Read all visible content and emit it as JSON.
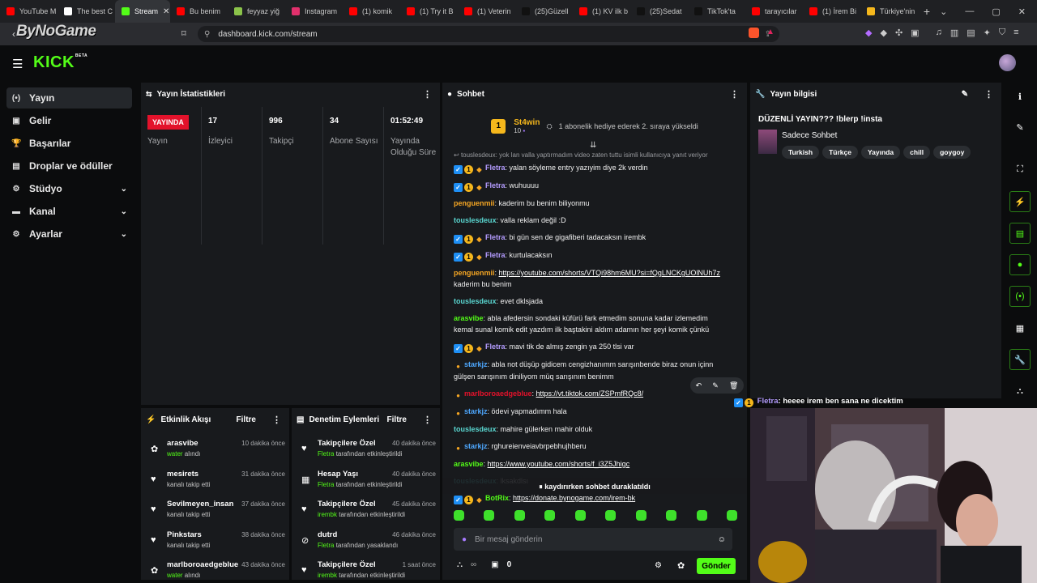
{
  "browser": {
    "tabs": [
      {
        "label": "YouTube M",
        "color": "#ff0000"
      },
      {
        "label": "The best C",
        "color": "#ffffff"
      },
      {
        "label": "Stream",
        "color": "#53fc18",
        "active": true
      },
      {
        "label": "Bu benim",
        "color": "#ff0000"
      },
      {
        "label": "feyyaz yiğ",
        "color": "#8bc34a"
      },
      {
        "label": "Instagram",
        "color": "#e1306c"
      },
      {
        "label": "(1) komik",
        "color": "#ff0000"
      },
      {
        "label": "(1) Try it B",
        "color": "#ff0000"
      },
      {
        "label": "(1) Veterin",
        "color": "#ff0000"
      },
      {
        "label": "(25)Güzell",
        "color": "#111111"
      },
      {
        "label": "(1) KV ilk b",
        "color": "#ff0000"
      },
      {
        "label": "(25)Sedat",
        "color": "#111111"
      },
      {
        "label": "TikTok'ta",
        "color": "#111111"
      },
      {
        "label": "tarayıcılar",
        "color": "#ff0000"
      },
      {
        "label": "(1) İrem Bi",
        "color": "#ff0000"
      },
      {
        "label": "Türkiye'nin",
        "color": "#f5b71c"
      }
    ],
    "url": "dashboard.kick.com/stream",
    "watermark": "ByNoGame"
  },
  "header": {
    "logo": "KICK",
    "logo_sup": "BETA"
  },
  "sidebar": {
    "items": [
      {
        "label": "Yayın",
        "icon": "broadcast-icon",
        "glyph": "(•)",
        "active": true
      },
      {
        "label": "Gelir",
        "icon": "revenue-icon",
        "glyph": "▣"
      },
      {
        "label": "Başarılar",
        "icon": "trophy-icon",
        "glyph": "🏆"
      },
      {
        "label": "Droplar ve ödüller",
        "icon": "drops-icon",
        "glyph": "▤"
      },
      {
        "label": "Stüdyo",
        "icon": "studio-icon",
        "glyph": "⚙",
        "chevron": true
      },
      {
        "label": "Kanal",
        "icon": "channel-icon",
        "glyph": "▬",
        "chevron": true
      },
      {
        "label": "Ayarlar",
        "icon": "settings-icon",
        "glyph": "⚙",
        "chevron": true
      }
    ]
  },
  "stats": {
    "title": "Yayın İstatistikleri",
    "live_badge": "YAYINDA",
    "live_label": "Yayın",
    "items": [
      {
        "value": "17",
        "label": "İzleyici"
      },
      {
        "value": "996",
        "label": "Takipçi"
      },
      {
        "value": "34",
        "label": "Abone Sayısı"
      },
      {
        "value": "01:52:49",
        "label": "Yayında Olduğu Süre"
      }
    ]
  },
  "chat": {
    "title": "Sohbet",
    "pinned_user": "St4win",
    "pinned_count": "10",
    "pinned_text": "1 abonelik hediye ederek 2. sıraya yükseldi",
    "reply_hint": "touslesdeux: yok lan valla yaptırmadım video zaten tuttu isimli kullanıcıya yanıt veriyor",
    "messages": [
      {
        "user": "Fletra",
        "color": "#b49cff",
        "badges": true,
        "text": "yalan söyleme entry yazıyim diye 2k verdin"
      },
      {
        "user": "Fletra",
        "color": "#b49cff",
        "badges": true,
        "text": "wuhuuuu"
      },
      {
        "user": "penguenmii",
        "color": "#f5a623",
        "text": "kaderim bu benim biliyonmu"
      },
      {
        "user": "touslesdeux",
        "color": "#5ad7d1",
        "text": "valla reklam değil :D"
      },
      {
        "user": "Fletra",
        "color": "#b49cff",
        "badges": true,
        "text": "bi gün sen de gigafiberi tadacaksın irembk"
      },
      {
        "user": "Fletra",
        "color": "#b49cff",
        "badges": true,
        "text": "kurtulacaksın"
      },
      {
        "user": "penguenmii",
        "color": "#f5a623",
        "link": "https://youtube.com/shorts/VTQi98hm6MU?si=fQgLNCKgUOlNUh7z",
        "text": "kaderim bu benim"
      },
      {
        "user": "touslesdeux",
        "color": "#5ad7d1",
        "text": "evet dklsjada"
      },
      {
        "user": "arasvibe",
        "color": "#53fc18",
        "text": "abla afedersin sondaki küfürü fark etmedim sonuna kadar izlemedim kemal sunal komik edit yazdım ilk baştakini aldım adamın her şeyi komik çünkü"
      },
      {
        "user": "Fletra",
        "color": "#b49cff",
        "badges": true,
        "text": "mavi tik de almış zengin ya 250 tlsi var"
      },
      {
        "user": "starkjz",
        "color": "#4ea8ff",
        "avatar": true,
        "text": "abla not düşüp gidicem cengizhanımm sarışınbende biraz onun içinn gülşen sarışınım diniliyom müq sarışınım benimm"
      },
      {
        "user": "marlboroaedgeblue",
        "color": "#e3122b",
        "avatar": true,
        "link": "https://vt.tiktok.com/ZSPmfRQc8/",
        "text": ""
      },
      {
        "user": "starkjz",
        "color": "#4ea8ff",
        "avatar": true,
        "text": "ödevi yapmadımm hala"
      },
      {
        "user": "touslesdeux",
        "color": "#5ad7d1",
        "text": "mahire gülerken mahir olduk"
      },
      {
        "user": "starkjz",
        "color": "#4ea8ff",
        "avatar": true,
        "text": "rghureienveiavbrpebhujhberu"
      },
      {
        "user": "arasvibe",
        "color": "#53fc18",
        "link": "https://www.youtube.com/shorts/f_i3Z5Jhigc",
        "text": ""
      },
      {
        "user": "touslesdeux",
        "color": "#5ad7d1",
        "text": "lksakdlsı"
      },
      {
        "user": "BotRix",
        "color": "#53fc18",
        "badges": true,
        "link": "https://donate.bynogame.com/irem-bk",
        "text": ""
      }
    ],
    "pause_text": "kaydırırken sohbet duraklatıldı",
    "input_placeholder": "Bir mesaj gönderin",
    "points": "0",
    "send_label": "Gönder"
  },
  "activity": {
    "title": "Etkinlik Akışı",
    "filter_label": "Filtre",
    "items": [
      {
        "name": "arasvibe",
        "sub_green": "water",
        "sub": "alındı",
        "time": "10 dakika önce",
        "icon": "gift-icon",
        "glyph": "✿"
      },
      {
        "name": "mesirets",
        "sub": "kanalı takip etti",
        "time": "31 dakika önce",
        "icon": "heart-icon",
        "glyph": "♥"
      },
      {
        "name": "Sevilmeyen_insan",
        "sub": "kanalı takip etti",
        "time": "37 dakika önce",
        "icon": "heart-icon",
        "glyph": "♥"
      },
      {
        "name": "Pinkstars",
        "sub": "kanalı takip etti",
        "time": "38 dakika önce",
        "icon": "heart-icon",
        "glyph": "♥"
      },
      {
        "name": "marlboroaedgeblue",
        "sub_green": "water",
        "sub": "alındı",
        "time": "43 dakika önce",
        "icon": "gift-icon",
        "glyph": "✿"
      }
    ]
  },
  "moderation": {
    "title": "Denetim Eylemleri",
    "filter_label": "Filtre",
    "items": [
      {
        "name": "Takipçilere Özel",
        "sub_green": "Fletra",
        "sub": "tarafından etkinleştirildi",
        "time": "40 dakika önce",
        "icon": "heart-icon",
        "glyph": "♥"
      },
      {
        "name": "Hesap Yaşı",
        "sub_green": "Fletra",
        "sub": "tarafından etkinleştirildi",
        "time": "40 dakika önce",
        "icon": "calendar-icon",
        "glyph": "▦"
      },
      {
        "name": "Takipçilere Özel",
        "sub_green": "irembk",
        "sub": "tarafından etkinleştirildi",
        "time": "45 dakika önce",
        "icon": "heart-icon",
        "glyph": "♥"
      },
      {
        "name": "dutrd",
        "sub_green": "Fletra",
        "sub": "tarafından yasaklandı",
        "time": "46 dakika önce",
        "icon": "ban-icon",
        "glyph": "⊘"
      },
      {
        "name": "Takipçilere Özel",
        "sub_green": "irembk",
        "sub": "tarafından etkinleştirildi",
        "time": "1 saat önce",
        "icon": "heart-icon",
        "glyph": "♥"
      }
    ]
  },
  "stream_info": {
    "title": "Yayın bilgisi",
    "stream_title": "DÜZENLİ YAYIN??? !blerp !insta",
    "category": "Sadece Sohbet",
    "tags": [
      "Turkish",
      "Türkçe",
      "Yayında",
      "chill",
      "goygoy"
    ]
  },
  "overlay": {
    "user": "Fletra",
    "text": "heeee irem ben sana ne dicektim"
  },
  "colors": {
    "accent": "#53fc18",
    "live": "#e3122b",
    "panel": "#181a1d"
  }
}
